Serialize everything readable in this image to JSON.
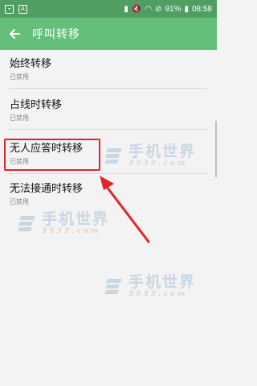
{
  "status_bar": {
    "battery": "91%",
    "time": "08:58"
  },
  "app_bar": {
    "title": "呼叫转移"
  },
  "items": [
    {
      "title": "始终转移",
      "subtitle": "已禁用"
    },
    {
      "title": "占线时转移",
      "subtitle": "已禁用"
    },
    {
      "title": "无人应答时转移",
      "subtitle": "已禁用"
    },
    {
      "title": "无法接通时转移",
      "subtitle": "已禁用"
    }
  ],
  "watermark": {
    "main": "手机世界",
    "sub": "3533.com"
  },
  "colors": {
    "status_bar": "#4f9f63",
    "app_bar": "#63bf79",
    "highlight": "#e0262b"
  }
}
